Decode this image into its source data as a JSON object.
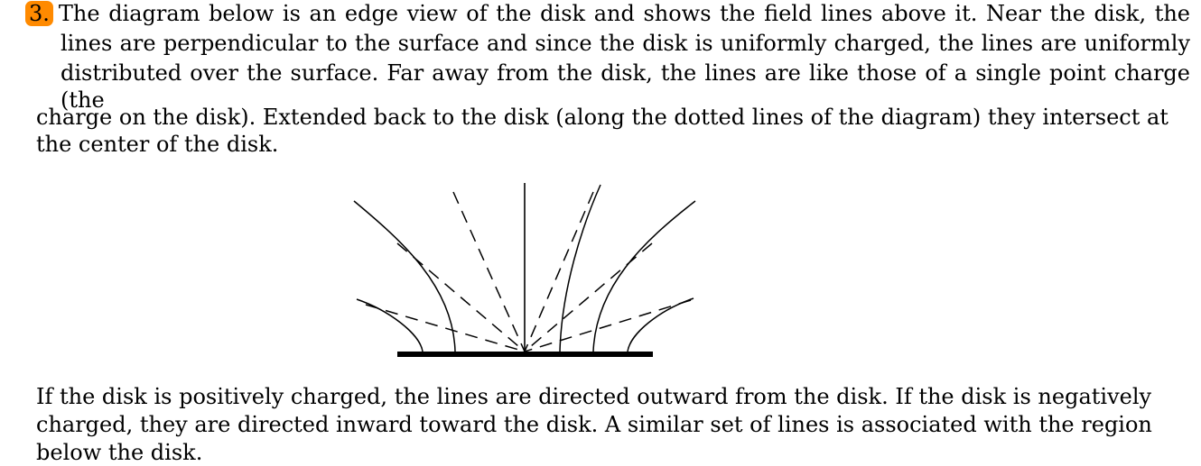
{
  "problem": {
    "number_label": "3.",
    "lines": [
      "The diagram below is an edge view of the disk and shows the field lines above it.  Near the disk, the",
      "lines are perpendicular to the surface and since the disk is uniformly charged, the lines are uniformly",
      "distributed over the surface.  Far away from the disk, the lines are like those of a single point charge (the",
      "charge on the disk).  Extended back to the disk (along the dotted lines of the diagram) they intersect at",
      "the center of the disk."
    ]
  },
  "after": {
    "lines": [
      "If the disk is positively charged, the lines are directed outward from the disk.  If the disk is negatively",
      "charged, they are directed inward toward the disk.  A similar set of lines is associated with the region",
      "below the disk."
    ]
  }
}
